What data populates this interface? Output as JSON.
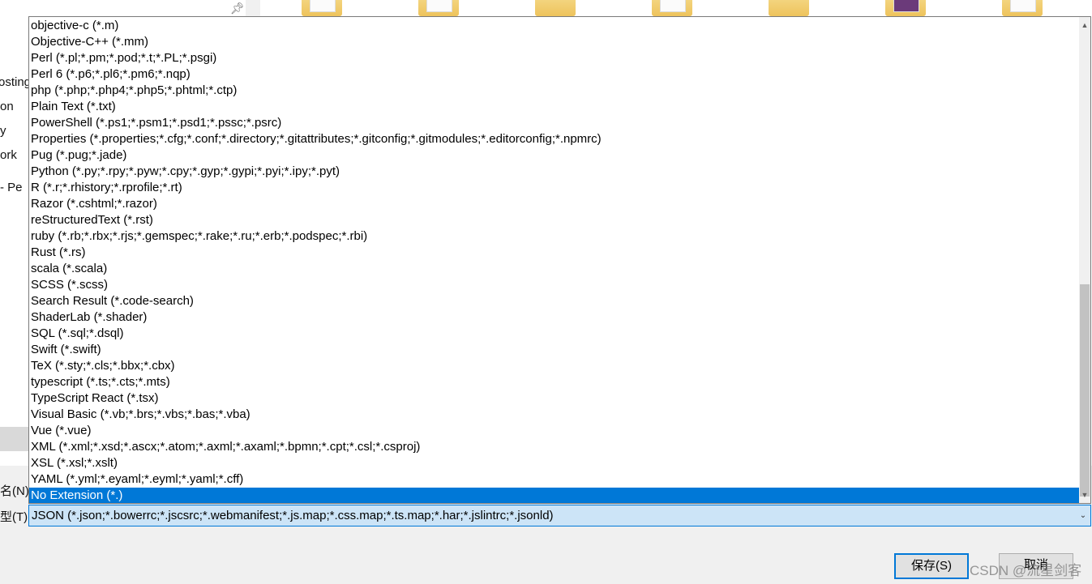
{
  "dropdown": {
    "items": [
      "objective-c (*.m)",
      "Objective-C++ (*.mm)",
      "Perl (*.pl;*.pm;*.pod;*.t;*.PL;*.psgi)",
      "Perl 6 (*.p6;*.pl6;*.pm6;*.nqp)",
      "php (*.php;*.php4;*.php5;*.phtml;*.ctp)",
      "Plain Text (*.txt)",
      "PowerShell (*.ps1;*.psm1;*.psd1;*.pssc;*.psrc)",
      "Properties (*.properties;*.cfg;*.conf;*.directory;*.gitattributes;*.gitconfig;*.gitmodules;*.editorconfig;*.npmrc)",
      "Pug (*.pug;*.jade)",
      "Python (*.py;*.rpy;*.pyw;*.cpy;*.gyp;*.gypi;*.pyi;*.ipy;*.pyt)",
      "R (*.r;*.rhistory;*.rprofile;*.rt)",
      "Razor (*.cshtml;*.razor)",
      "reStructuredText (*.rst)",
      "ruby (*.rb;*.rbx;*.rjs;*.gemspec;*.rake;*.ru;*.erb;*.podspec;*.rbi)",
      "Rust (*.rs)",
      "scala (*.scala)",
      "SCSS (*.scss)",
      "Search Result (*.code-search)",
      "ShaderLab (*.shader)",
      "SQL (*.sql;*.dsql)",
      "Swift (*.swift)",
      "TeX (*.sty;*.cls;*.bbx;*.cbx)",
      "typescript (*.ts;*.cts;*.mts)",
      "TypeScript React (*.tsx)",
      "Visual Basic (*.vb;*.brs;*.vbs;*.bas;*.vba)",
      "Vue (*.vue)",
      "XML (*.xml;*.xsd;*.ascx;*.atom;*.axml;*.axaml;*.bpmn;*.cpt;*.csl;*.csproj)",
      "XSL (*.xsl;*.xslt)",
      "YAML (*.yml;*.eyaml;*.eyml;*.yaml;*.cff)",
      "No Extension (*.)"
    ],
    "selected_index": 29
  },
  "save_type": {
    "label": "型(T):",
    "value": "JSON (*.json;*.bowerrc;*.jscsrc;*.webmanifest;*.js.map;*.css.map;*.ts.map;*.har;*.jslintrc;*.jsonld)"
  },
  "filename": {
    "label": "名(N):"
  },
  "side_nav": {
    "items": [
      "osting",
      "on",
      "y",
      "ork",
      "- Pe"
    ]
  },
  "buttons": {
    "save": "保存(S)",
    "cancel": "取消"
  },
  "watermark": "CSDN @流星剑客",
  "colors": {
    "selection": "#0078d7",
    "combo_background": "#cce4f7",
    "dialog_background": "#f0f0f0"
  }
}
